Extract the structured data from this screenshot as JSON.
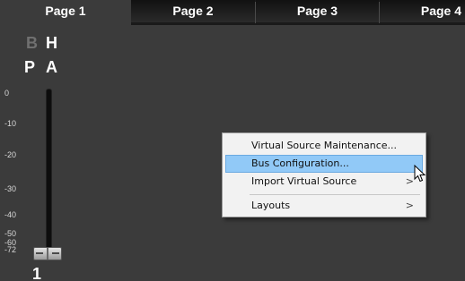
{
  "tabs": [
    {
      "label": "Page 1",
      "active": true
    },
    {
      "label": "Page 2",
      "active": false
    },
    {
      "label": "Page 3",
      "active": false
    },
    {
      "label": "Page 4",
      "active": false
    }
  ],
  "strip": {
    "buttons": {
      "b": "B",
      "h": "H",
      "p": "P",
      "a": "A"
    },
    "scale": [
      "0",
      "-10",
      "-20",
      "-30",
      "-40",
      "-50",
      "-60",
      "-72"
    ],
    "channel_number": "1"
  },
  "context_menu": {
    "items": [
      {
        "label": "Virtual Source Maintenance...",
        "submenu": false
      },
      {
        "label": "Bus Configuration...",
        "submenu": false,
        "highlighted": true
      },
      {
        "label": "Import Virtual Source",
        "submenu": true
      },
      {
        "label": "Layouts",
        "submenu": true
      }
    ],
    "submenu_arrow": ">"
  },
  "colors": {
    "background": "#3b3b3b",
    "tab_bar": "#1a1a1a",
    "menu_bg": "#f2f2f2",
    "menu_highlight": "#91c9f7"
  },
  "icons": {
    "cursor": "arrow-pointer-icon"
  }
}
